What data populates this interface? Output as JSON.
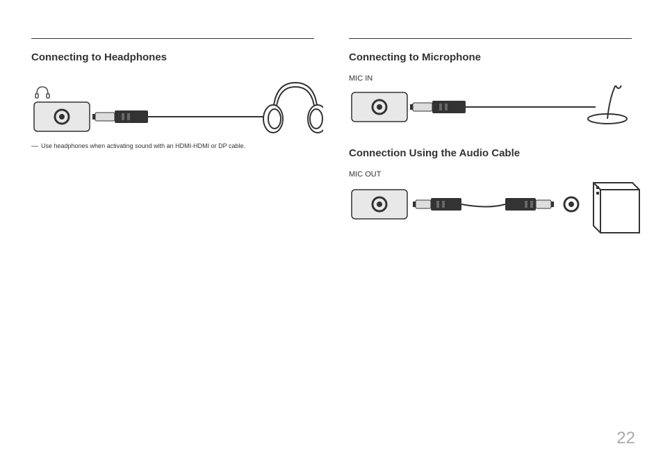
{
  "left": {
    "title": "Connecting to Headphones",
    "footnote": "Use headphones when activating sound with an HDMI-HDMI or DP cable."
  },
  "right": {
    "title1": "Connecting to Microphone",
    "mic_in_label": "MIC IN",
    "title2": "Connection Using the Audio Cable",
    "mic_out_label": "MIC OUT"
  },
  "page_number": "22"
}
